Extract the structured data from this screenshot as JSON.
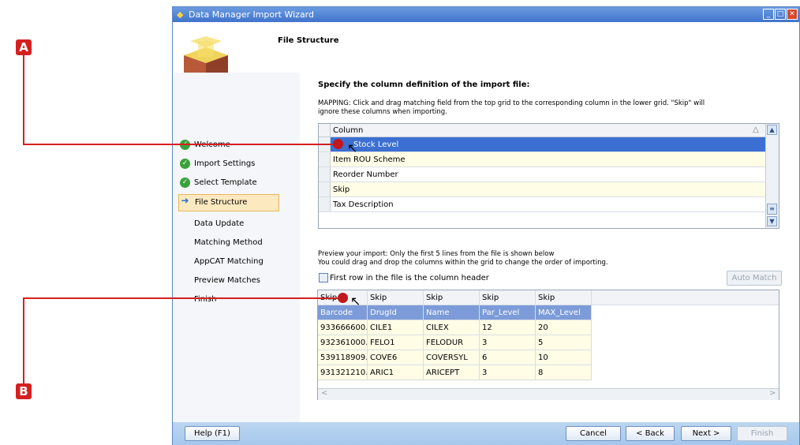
{
  "window": {
    "title": "Data Manager Import Wizard",
    "page_heading": "File Structure"
  },
  "steps": [
    {
      "label": "Welcome",
      "state": "done"
    },
    {
      "label": "Import Settings",
      "state": "done"
    },
    {
      "label": "Select Template",
      "state": "done"
    },
    {
      "label": "File Structure",
      "state": "current"
    },
    {
      "label": "Data Update",
      "state": "pending"
    },
    {
      "label": "Matching Method",
      "state": "pending"
    },
    {
      "label": "AppCAT Matching",
      "state": "pending"
    },
    {
      "label": "Preview Matches",
      "state": "pending"
    },
    {
      "label": "Finish",
      "state": "pending"
    }
  ],
  "main": {
    "heading": "Specify the column definition of the import file:",
    "mapping_line1": "MAPPING: Click and drag matching field from the top grid to the corresponding column in the lower grid. \"Skip\" will",
    "mapping_line2": "ignore these columns when importing.",
    "preview_line1": "Preview your import: Only the first 5 lines from the file is shown below",
    "preview_line2": "You could drag and drop the columns within the grid to change the order of importing.",
    "checkbox_label": "First row in the file is the column header",
    "auto_match": "Auto Match"
  },
  "column_grid": {
    "header": "Column",
    "rows": [
      "Stock Level",
      "Item ROU Scheme",
      "Reorder Number",
      "Skip",
      "Tax Description"
    ]
  },
  "preview_grid": {
    "headers": [
      "Skip",
      "Skip",
      "Skip",
      "Skip",
      "Skip"
    ],
    "rows": [
      [
        "Barcode",
        "DrugId",
        "Name",
        "Par_Level",
        "MAX_Level"
      ],
      [
        "933666600...",
        "CILE1",
        "CILEX",
        "12",
        "20"
      ],
      [
        "932361000...",
        "FELO1",
        "FELODUR",
        "3",
        "5"
      ],
      [
        "539118909...",
        "COVE6",
        "COVERSYL",
        "6",
        "10"
      ],
      [
        "931321210...",
        "ARIC1",
        "ARICEPT",
        "3",
        "8"
      ]
    ]
  },
  "footer": {
    "help": "Help (F1)",
    "cancel": "Cancel",
    "back": "< Back",
    "next": "Next >",
    "finish": "Finish"
  },
  "markers": {
    "a": "A",
    "b": "B"
  },
  "colors": {
    "marker": "#d61f1f",
    "title_bar": "#4a7fd4",
    "selected_row": "#3b6fd1",
    "active_step": "#fde9c0"
  }
}
